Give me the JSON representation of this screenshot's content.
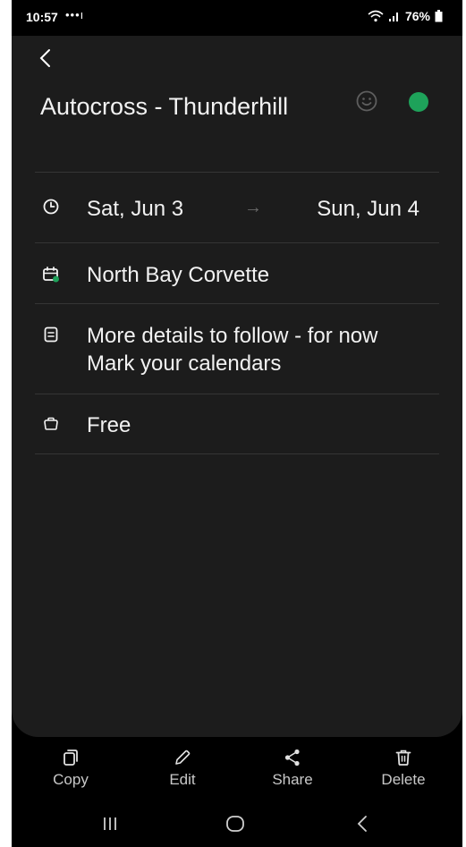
{
  "status": {
    "time": "10:57",
    "dots": "•••ı",
    "battery": "76%"
  },
  "event": {
    "title": "Autocross - Thunderhill",
    "color": "#1ea25a",
    "start_date": "Sat, Jun 3",
    "end_date": "Sun, Jun 4",
    "calendar": "North Bay Corvette",
    "description": "More details to follow - for now Mark your calendars",
    "availability": "Free"
  },
  "icons": {
    "back": "chevron-left-icon",
    "emoji": "smile-icon",
    "time": "clock-icon",
    "calendar": "calendar-icon",
    "description": "note-icon",
    "availability": "briefcase-icon"
  },
  "toolbar": {
    "copy_label": "Copy",
    "edit_label": "Edit",
    "share_label": "Share",
    "delete_label": "Delete"
  },
  "colors": {
    "background": "#000000",
    "sheet": "#1c1c1c",
    "accent_green": "#1ea25a",
    "text": "#f2f2f2"
  }
}
